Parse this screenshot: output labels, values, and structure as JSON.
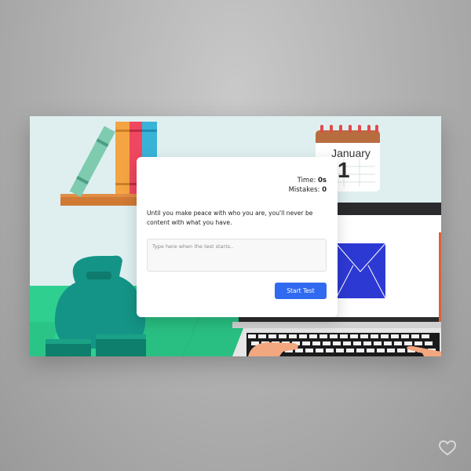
{
  "calendar": {
    "month": "January",
    "day": "1"
  },
  "test": {
    "time_label": "Time:",
    "time_value": "0s",
    "mistakes_label": "Mistakes:",
    "mistakes_value": "0",
    "quote": "Until you make peace with who you are, you'll never be content with what you have.",
    "input_placeholder": "Type here when the test starts..",
    "input_value": "",
    "start_button": "Start Test"
  },
  "colors": {
    "accent": "#2f6af0",
    "scene_wall": "#dfeff0",
    "floor": "#2fcf8f",
    "bag": "#149486",
    "envelope": "#2d39d3"
  },
  "icons": {
    "envelope": "mail-icon",
    "watermark": "heart-icon"
  }
}
